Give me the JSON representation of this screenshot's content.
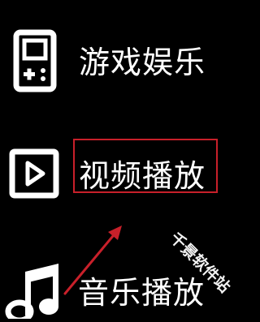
{
  "menu": {
    "items": [
      {
        "label": "游戏娱乐",
        "icon": "gamepad-icon"
      },
      {
        "label": "视频播放",
        "icon": "play-icon",
        "highlighted": true
      },
      {
        "label": "音乐播放",
        "icon": "music-note-icon"
      }
    ]
  },
  "watermark": {
    "text": "千景软件站"
  },
  "colors": {
    "background": "#000000",
    "text": "#ffffff",
    "highlight": "#c8202a",
    "arrow": "#c8202a"
  }
}
